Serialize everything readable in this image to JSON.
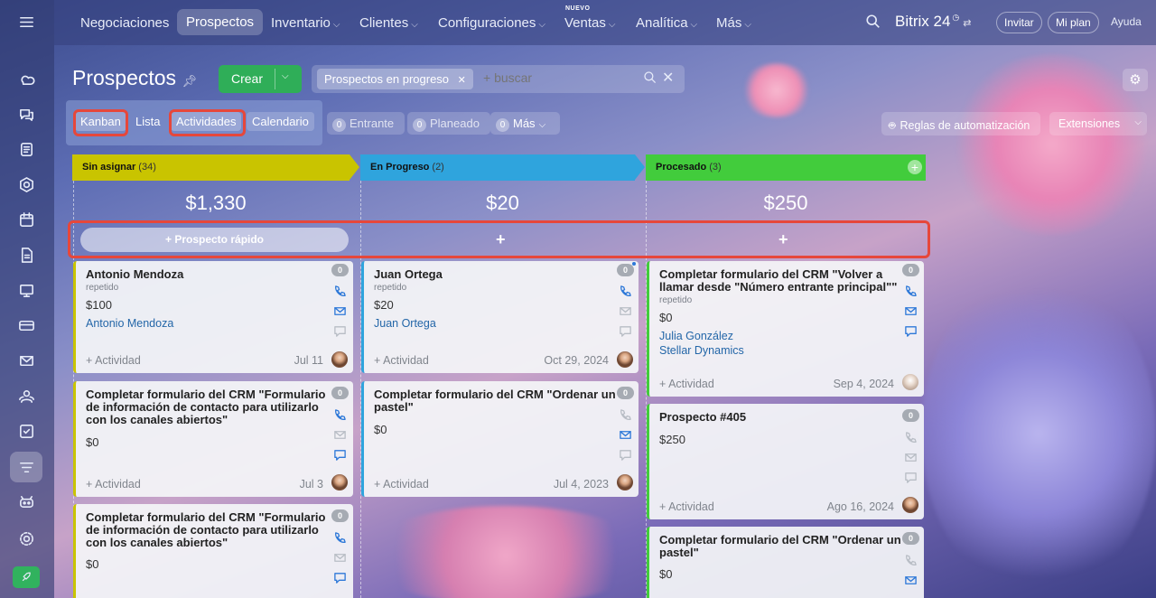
{
  "sidebar": {
    "icons": [
      "menu-icon",
      "activity-stream-icon",
      "chat-icon",
      "tasks-icon",
      "crm-icon",
      "calendar-icon",
      "docs-icon",
      "sites-icon",
      "billing-icon",
      "mail-icon",
      "contacts-icon",
      "checklist-icon",
      "funnel-icon",
      "robot-icon",
      "settings-icon",
      "rocket-icon"
    ]
  },
  "topnav": {
    "items": [
      {
        "label": "Negociaciones",
        "chevron": false
      },
      {
        "label": "Prospectos",
        "chevron": false,
        "active": true
      },
      {
        "label": "Inventario",
        "chevron": true
      },
      {
        "label": "Clientes",
        "chevron": true
      },
      {
        "label": "Configuraciones",
        "chevron": true
      },
      {
        "label": "Ventas",
        "chevron": true,
        "tag": "NUEVO"
      },
      {
        "label": "Analítica",
        "chevron": true
      },
      {
        "label": "Más",
        "chevron": true
      }
    ],
    "brand": "Bitrix 24",
    "invite": "Invitar",
    "plan": "Mi plan",
    "help": "Ayuda"
  },
  "page": {
    "title": "Prospectos",
    "create": "Crear",
    "filter_tag": "Prospectos en progreso",
    "search_placeholder": "+ buscar"
  },
  "views": {
    "kanban": "Kanban",
    "list": "Lista",
    "activities": "Actividades",
    "calendar": "Calendario"
  },
  "counters": [
    {
      "count": "0",
      "label": "Entrante"
    },
    {
      "count": "0",
      "label": "Planeado"
    },
    {
      "count": "0",
      "label": "Más"
    }
  ],
  "automation": "Reglas de automatización",
  "extensions": "Extensiones",
  "quick_add": "Prospecto rápido",
  "columns": [
    {
      "name": "Sin asignar",
      "count": "(34)",
      "sum": "$1,330",
      "color": "#c9c400"
    },
    {
      "name": "En Progreso",
      "count": "(2)",
      "sum": "$20",
      "color": "#2fa4dd"
    },
    {
      "name": "Procesado",
      "count": "(3)",
      "sum": "$250",
      "color": "#42cc3c"
    }
  ],
  "cards": {
    "c1": {
      "title": "Antonio Mendoza",
      "sub": "repetido",
      "amount": "$100",
      "contact": "Antonio Mendoza",
      "activity": "+ Actividad",
      "date": "Jul 11",
      "badge": "0"
    },
    "c2": {
      "title": "Completar formulario del CRM \"Formulario de información de contacto para utilizarlo con los canales abiertos\"",
      "amount": "$0",
      "activity": "+ Actividad",
      "date": "Jul 3",
      "badge": "0"
    },
    "c3": {
      "title": "Completar formulario del CRM \"Formulario de información de contacto para utilizarlo con los canales abiertos\"",
      "amount": "$0",
      "badge": "0"
    },
    "c4": {
      "title": "Juan Ortega",
      "sub": "repetido",
      "amount": "$20",
      "contact": "Juan Ortega",
      "activity": "+ Actividad",
      "date": "Oct 29, 2024",
      "badge": "0"
    },
    "c5": {
      "title": "Completar formulario del CRM \"Ordenar un pastel\"",
      "amount": "$0",
      "activity": "+ Actividad",
      "date": "Jul 4, 2023",
      "badge": "0"
    },
    "c6": {
      "title": "Completar formulario del CRM \"Volver a llamar desde \"Número entrante principal\"\"",
      "sub": "repetido",
      "amount": "$0",
      "contact": "Julia González",
      "company": "Stellar Dynamics",
      "activity": "+ Actividad",
      "date": "Sep 4, 2024",
      "badge": "0"
    },
    "c7": {
      "title": "Prospecto #405",
      "amount": "$250",
      "activity": "+ Actividad",
      "date": "Ago 16, 2024",
      "badge": "0"
    },
    "c8": {
      "title": "Completar formulario del CRM \"Ordenar un pastel\"",
      "amount": "$0",
      "badge": "0"
    }
  }
}
